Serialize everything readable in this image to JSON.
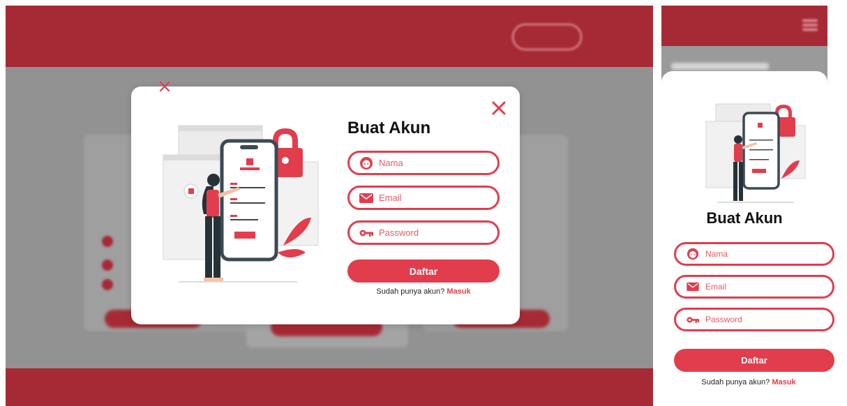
{
  "colors": {
    "accent": "#e23d4c",
    "header_dim": "#a62a35",
    "overlay": "#9a9a9a"
  },
  "background": {
    "logo_text": "",
    "nav": [
      "",
      ""
    ],
    "masuk_button": "",
    "page_title": "",
    "footer_text": ""
  },
  "modal": {
    "title": "Buat Akun",
    "fields": [
      {
        "icon": "face-icon",
        "placeholder": "Nama"
      },
      {
        "icon": "envelope-icon",
        "placeholder": "Email"
      },
      {
        "icon": "key-icon",
        "placeholder": "Password"
      }
    ],
    "submit_label": "Daftar",
    "login_prompt": "Sudah punya akun?",
    "login_link": "Masuk",
    "close_icon": "close-icon",
    "illustration": "woman-phone-login-illustration"
  },
  "mobile": {
    "title": "Buat Akun",
    "fields": [
      {
        "icon": "face-icon",
        "placeholder": "Nama"
      },
      {
        "icon": "envelope-icon",
        "placeholder": "Email"
      },
      {
        "icon": "key-icon",
        "placeholder": "Password"
      }
    ],
    "submit_label": "Daftar",
    "login_prompt": "Sudah punya akun?",
    "login_link": "Masuk"
  }
}
